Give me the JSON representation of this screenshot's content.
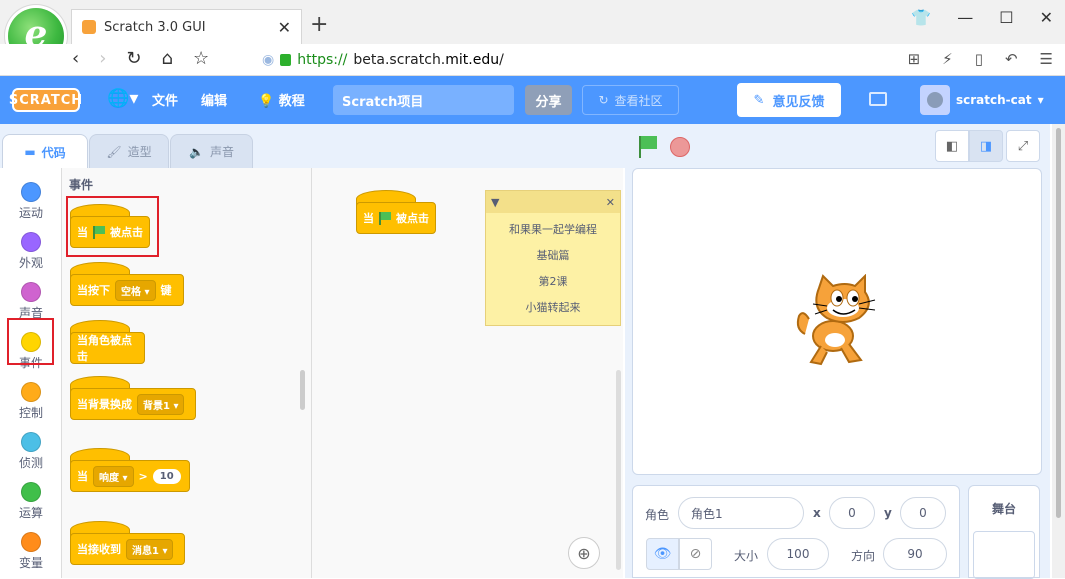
{
  "browser": {
    "tab_title": "Scratch 3.0 GUI",
    "url_scheme": "https://",
    "url_sub": "beta.scratch.",
    "url_host": "mit.edu",
    "url_path": "/"
  },
  "menubar": {
    "logo": "SCRATCH",
    "file": "文件",
    "edit": "编辑",
    "tutorials": "教程",
    "project_title": "Scratch项目",
    "share": "分享",
    "see_community": "查看社区",
    "feedback": "意见反馈",
    "username": "scratch-cat"
  },
  "editor_tabs": {
    "code": "代码",
    "costumes": "造型",
    "sounds": "声音"
  },
  "categories": [
    {
      "label": "运动",
      "color": "#4c97ff"
    },
    {
      "label": "外观",
      "color": "#9966ff"
    },
    {
      "label": "声音",
      "color": "#cf63cf"
    },
    {
      "label": "事件",
      "color": "#ffd500"
    },
    {
      "label": "控制",
      "color": "#ffab19"
    },
    {
      "label": "侦测",
      "color": "#4cbfe6"
    },
    {
      "label": "运算",
      "color": "#40bf4a"
    },
    {
      "label": "变量",
      "color": "#ff8c1a"
    }
  ],
  "flyout": {
    "title": "事件",
    "b1_when": "当",
    "b1_clicked": "被点击",
    "b2_when": "当按下",
    "b2_key": "空格",
    "b2_key_suffix": "键",
    "b3": "当角色被点击",
    "b4_text": "当背景换成",
    "b4_backdrop": "背景1",
    "b5_when": "当",
    "b5_sensor": "响度",
    "b5_op": ">",
    "b5_value": "10",
    "b6_text": "当接收到",
    "b6_msg": "消息1"
  },
  "workspace": {
    "script_when": "当",
    "script_clicked": "被点击",
    "note_lines": [
      "和果果一起学编程",
      "基础篇",
      "第2课",
      "小猫转起来"
    ]
  },
  "sprite_info": {
    "sprite_label": "角色",
    "sprite_name": "角色1",
    "x_label": "x",
    "x_value": "0",
    "y_label": "y",
    "y_value": "0",
    "size_label": "大小",
    "size_value": "100",
    "direction_label": "方向",
    "direction_value": "90"
  },
  "stage_pane": {
    "title": "舞台"
  }
}
